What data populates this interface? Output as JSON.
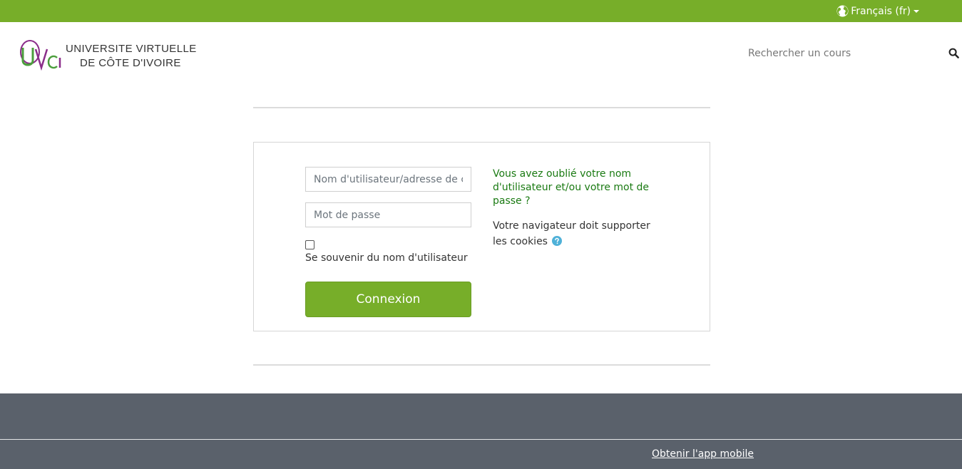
{
  "topbar": {
    "language_label": "Français (fr)",
    "bg_color": "#77ae29"
  },
  "header": {
    "logo_mark": "UVCI",
    "logo_line1": "UNIVERSITE VIRTUELLE",
    "logo_line2": "DE CÔTE D'IVOIRE",
    "search_placeholder": "Rechercher un cours",
    "search_icon": "search-icon"
  },
  "login": {
    "username_placeholder": "Nom d'utilisateur/adresse de courriel",
    "password_placeholder": "Mot de passe",
    "remember_label": "Se souvenir du nom d'utilisateur",
    "remember_checked": false,
    "submit_label": "Connexion",
    "forgot_link": "Vous avez oublié votre nom d'utilisateur et/ou votre mot de passe ?",
    "cookies_text": "Votre navigateur doit supporter les cookies",
    "help_icon": "question-circle-icon"
  },
  "footer": {
    "mobile_app_link": "Obtenir l'app mobile",
    "bg_color": "#5a616b"
  },
  "colors": {
    "accent": "#77ae29",
    "link": "#1a7a12",
    "logo_purple": "#8b2e8a",
    "logo_green": "#4b9e3c"
  }
}
